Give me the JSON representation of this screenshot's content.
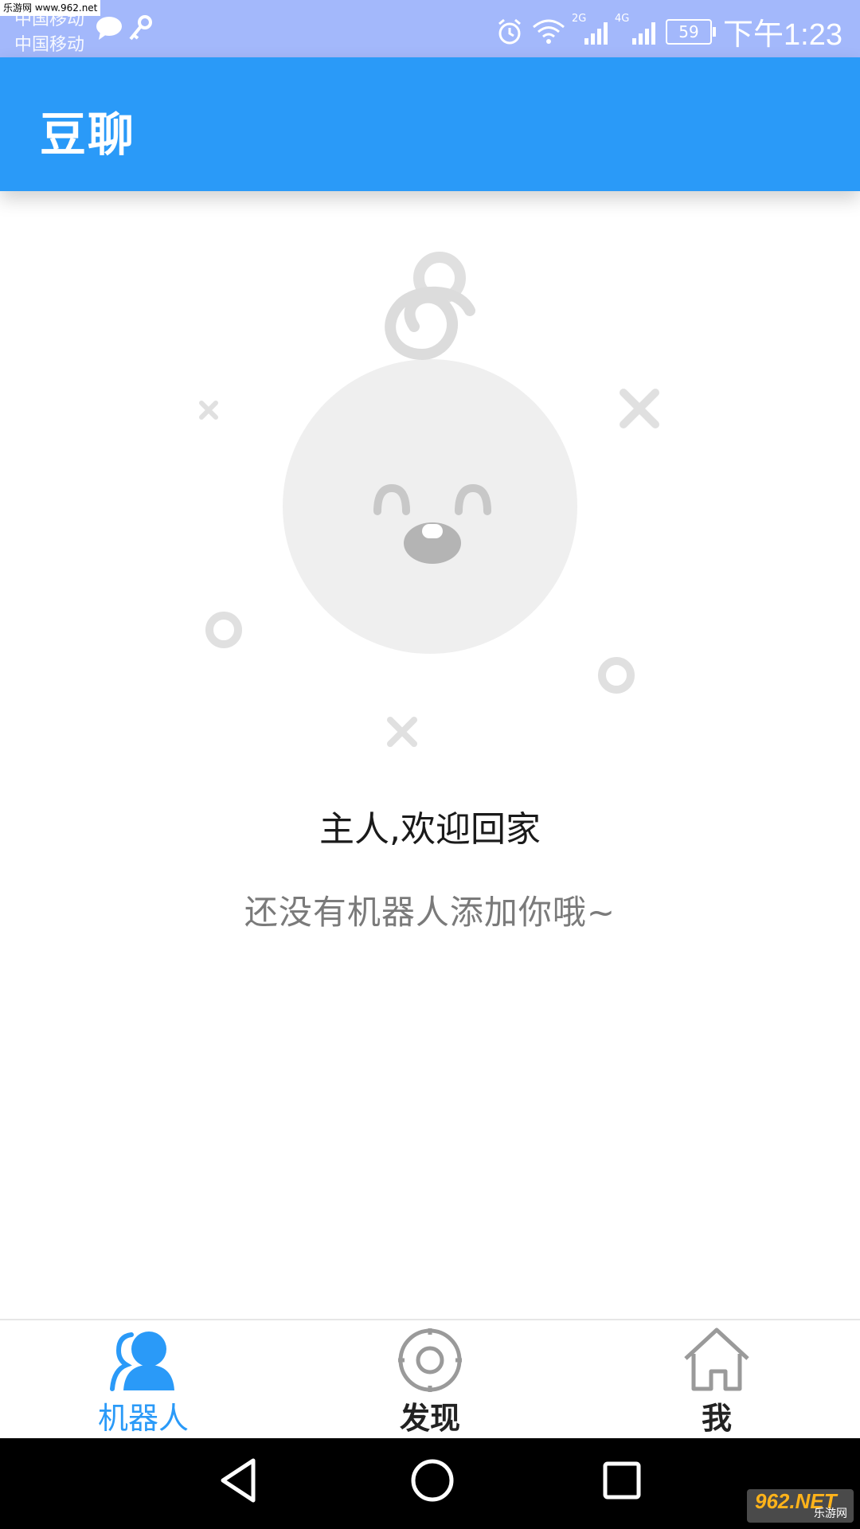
{
  "status_bar": {
    "watermark": "乐游网 www.962.net",
    "carrier_1": "中国移动",
    "carrier_2": "中国移动",
    "network_1": "2G",
    "network_2": "4G",
    "battery": "59",
    "time": "下午1:23"
  },
  "app_bar": {
    "title": "豆聊"
  },
  "empty_state": {
    "welcome": "主人,欢迎回家",
    "hint": "还没有机器人添加你哦~"
  },
  "bottom_nav": {
    "items": [
      {
        "label": "机器人",
        "icon": "robot-person-icon",
        "active": true
      },
      {
        "label": "发现",
        "icon": "discover-target-icon",
        "active": false
      },
      {
        "label": "我",
        "icon": "home-icon",
        "active": false
      }
    ]
  },
  "colors": {
    "primary": "#2a9af8",
    "status_bar": "#a3b8fb",
    "illustration_gray": "#e0e0e0"
  },
  "watermark_bottom": {
    "top": "962.NET",
    "bottom": "乐游网"
  }
}
